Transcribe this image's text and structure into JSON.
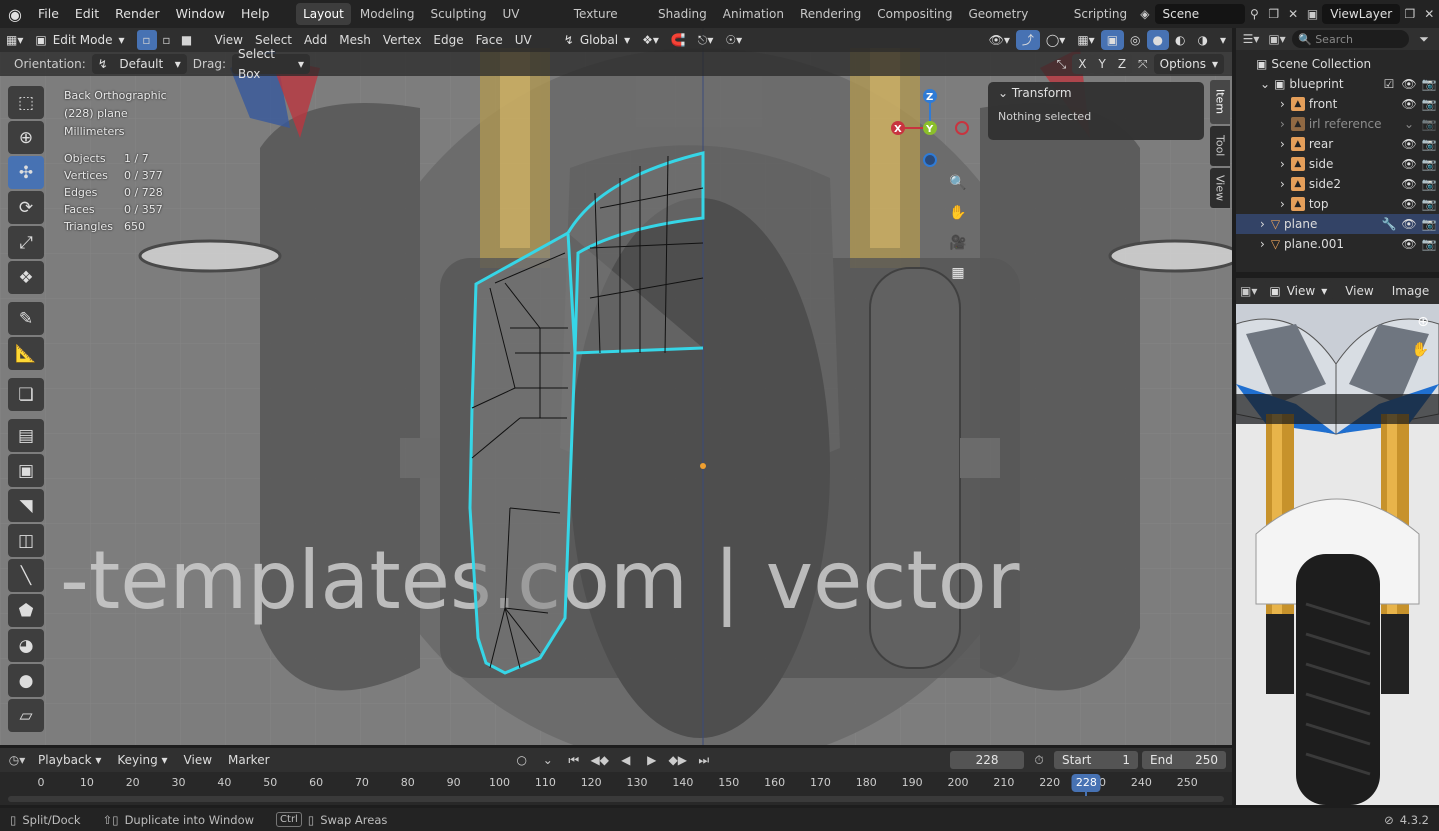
{
  "topbar": {
    "menus": [
      "File",
      "Edit",
      "Render",
      "Window",
      "Help"
    ],
    "workspaces": [
      "Layout",
      "Modeling",
      "Sculpting",
      "UV Editing",
      "Texture Paint",
      "Shading",
      "Animation",
      "Rendering",
      "Compositing",
      "Geometry Nodes",
      "Scripting"
    ],
    "active_workspace": "Layout",
    "scene": "Scene",
    "view_layer": "ViewLayer"
  },
  "viewport_header": {
    "mode": "Edit Mode",
    "menus": [
      "View",
      "Select",
      "Add",
      "Mesh",
      "Vertex",
      "Edge",
      "Face",
      "UV"
    ],
    "transform_orientation": "Global",
    "orientation_label": "Orientation:",
    "orientation_value": "Default",
    "drag_label": "Drag:",
    "drag_value": "Select Box",
    "axes": [
      "X",
      "Y",
      "Z"
    ],
    "options": "Options"
  },
  "viewport_info": {
    "view": "Back Orthographic",
    "object": "(228) plane",
    "units": "Millimeters",
    "stats": [
      {
        "label": "Objects",
        "value": "1 / 7"
      },
      {
        "label": "Vertices",
        "value": "0 / 377"
      },
      {
        "label": "Edges",
        "value": "0 / 728"
      },
      {
        "label": "Faces",
        "value": "0 / 357"
      },
      {
        "label": "Triangles",
        "value": "650"
      }
    ],
    "watermark": "-templates.com | vector"
  },
  "transform_panel": {
    "title": "Transform",
    "message": "Nothing selected"
  },
  "side_tabs": [
    "Item",
    "Tool",
    "View"
  ],
  "gizmo": {
    "x": "X",
    "y": "Y",
    "z": "Z"
  },
  "outliner": {
    "search_placeholder": "Search",
    "root": "Scene Collection",
    "collection": "blueprint",
    "items": [
      {
        "name": "front"
      },
      {
        "name": "irl reference"
      },
      {
        "name": "rear"
      },
      {
        "name": "side"
      },
      {
        "name": "side2"
      },
      {
        "name": "top"
      }
    ],
    "objects": [
      {
        "name": "plane"
      },
      {
        "name": "plane.001"
      }
    ]
  },
  "image_editor": {
    "view_label": "View",
    "menus": [
      "View",
      "Image"
    ]
  },
  "timeline": {
    "menus": [
      "Playback",
      "Keying",
      "View",
      "Marker"
    ],
    "current_frame": "228",
    "start_label": "Start",
    "start": "1",
    "end_label": "End",
    "end": "250",
    "ticks": [
      "0",
      "10",
      "20",
      "30",
      "40",
      "50",
      "60",
      "70",
      "80",
      "90",
      "100",
      "110",
      "120",
      "130",
      "140",
      "150",
      "160",
      "170",
      "180",
      "190",
      "200",
      "210",
      "220",
      "230",
      "240",
      "250"
    ],
    "marker_frame": "228"
  },
  "statusbar": {
    "split": "Split/Dock",
    "duplicate": "Duplicate into Window",
    "ctrl": "Ctrl",
    "swap": "Swap Areas",
    "version": "4.3.2"
  },
  "colors": {
    "accent": "#4772b3",
    "mesh_edge": "#36d6e7",
    "header": "#303030",
    "gizmo_x": "#c8343f",
    "gizmo_y": "#8bbf2b",
    "gizmo_z": "#2f7bd6"
  }
}
